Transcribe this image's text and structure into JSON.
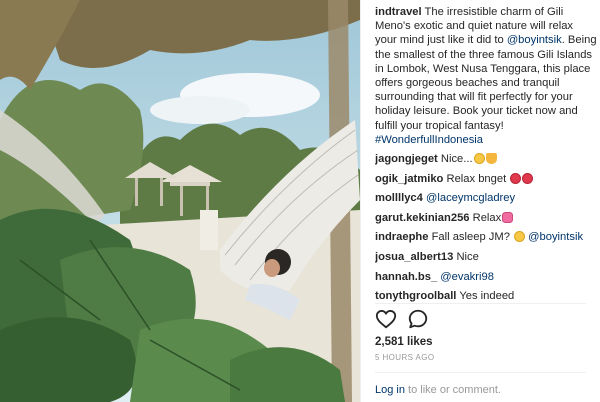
{
  "post": {
    "author": "indtravel",
    "caption_text": "The irresistible charm of Gili Meno's exotic and quiet nature will relax your mind just like it did to ",
    "caption_mention": "@boyintsik",
    "caption_text_2": ". Being the smallest of the three famous Gili Islands in Lombok, West Nusa Tenggara, this place offers gorgeous beaches and tranquil surrounding that will fit perfectly for your holiday leisure. Book your ticket now and fulfill your tropical fantasy!",
    "caption_hashtag": "#WonderfullIndonesia"
  },
  "comments": [
    {
      "user": "jagongjeget",
      "text": "Nice...",
      "emoji": [
        "yellow",
        "thumb"
      ]
    },
    {
      "user": "ogik_jatmiko",
      "text": "Relax bnget",
      "emoji": [
        "red",
        "red"
      ]
    },
    {
      "user": "mollllyc4",
      "mention": "@laceymcgladrey"
    },
    {
      "user": "garut.kekinian256",
      "text": "Relax",
      "emoji": [
        "pink"
      ]
    },
    {
      "user": "indraephe",
      "text": "Fall asleep JM?",
      "emoji": [
        "yellow"
      ],
      "mention": "@boyintsik"
    },
    {
      "user": "josua_albert13",
      "text": "Nice"
    },
    {
      "user": "hannah.bs_",
      "mention": "@evakri98"
    },
    {
      "user": "tonythgroolball",
      "text": "Yes indeed"
    }
  ],
  "actions": {
    "like_icon": "heart-icon",
    "comment_icon": "comment-bubble-icon"
  },
  "likes": "2,581 likes",
  "timestamp": "5 HOURS AGO",
  "login": {
    "link": "Log in",
    "text": " to like or comment."
  },
  "colors": {
    "link": "#003569",
    "muted": "#999999",
    "text": "#262626"
  }
}
